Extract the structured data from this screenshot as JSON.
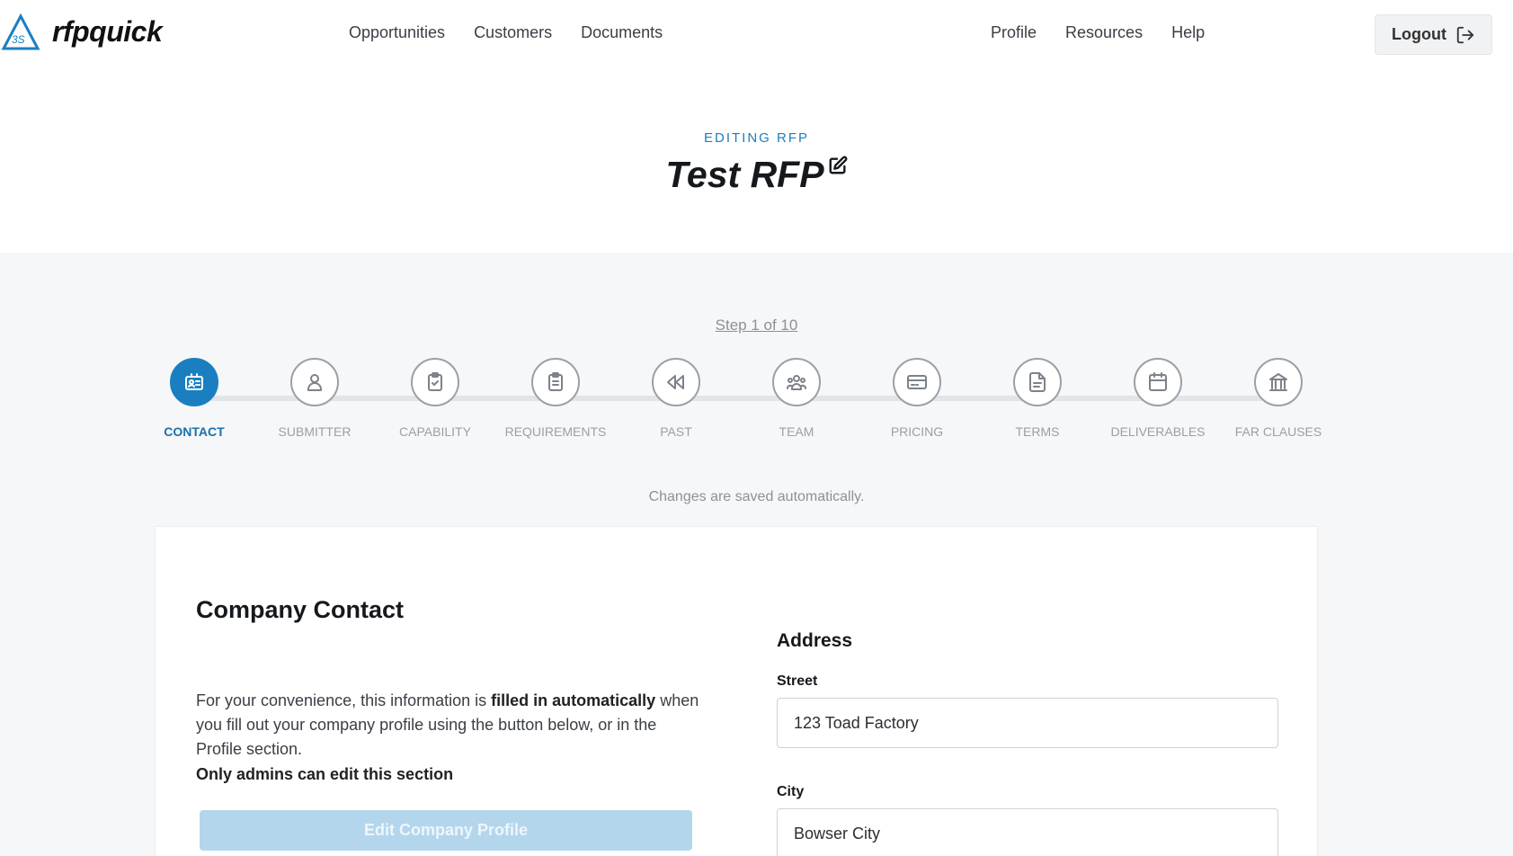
{
  "header": {
    "brand": "rfpquick",
    "nav_left": [
      "Opportunities",
      "Customers",
      "Documents"
    ],
    "nav_right": [
      "Profile",
      "Resources",
      "Help"
    ],
    "logout_label": "Logout"
  },
  "title_section": {
    "eyebrow": "EDITING RFP",
    "title": "Test RFP"
  },
  "wizard": {
    "step_text": "Step 1 of 10",
    "active_step": 0,
    "steps": [
      {
        "label": "CONTACT",
        "icon": "contact-card-icon"
      },
      {
        "label": "SUBMITTER",
        "icon": "person-icon"
      },
      {
        "label": "CAPABILITY",
        "icon": "clipboard-check-icon"
      },
      {
        "label": "REQUIREMENTS",
        "icon": "clipboard-list-icon"
      },
      {
        "label": "PAST",
        "icon": "rewind-icon"
      },
      {
        "label": "TEAM",
        "icon": "team-icon"
      },
      {
        "label": "PRICING",
        "icon": "credit-card-icon"
      },
      {
        "label": "TERMS",
        "icon": "document-icon"
      },
      {
        "label": "DELIVERABLES",
        "icon": "calendar-icon"
      },
      {
        "label": "FAR CLAUSES",
        "icon": "bank-icon"
      }
    ],
    "saved_note": "Changes are saved automatically."
  },
  "contact_card": {
    "title": "Company Contact",
    "desc_part1": "For your convenience, this information is ",
    "desc_bold": "filled in automatically",
    "desc_part2": " when you fill out your company profile using the button below, or in the Profile section.",
    "admin_note": "Only admins can edit this section",
    "edit_button": "Edit Company Profile",
    "address_heading": "Address",
    "street_label": "Street",
    "street_value": "123 Toad Factory",
    "city_label": "City",
    "city_value": "Bowser City"
  },
  "colors": {
    "accent": "#1a7fc1",
    "disabled_button": "#b3d6ed",
    "page_grey": "#f6f7f8"
  }
}
